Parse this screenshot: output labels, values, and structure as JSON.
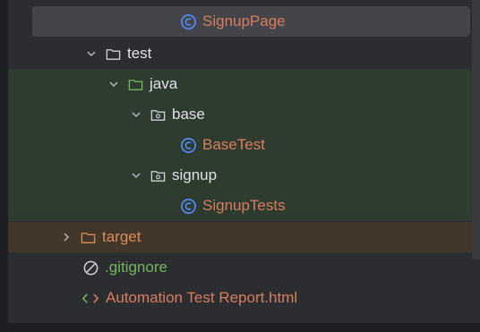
{
  "tree": {
    "items": [
      {
        "label": "SignupPage",
        "icon": "class-icon"
      },
      {
        "label": "test",
        "icon": "folder-icon"
      },
      {
        "label": "java",
        "icon": "source-folder-icon"
      },
      {
        "label": "base",
        "icon": "package-icon"
      },
      {
        "label": "BaseTest",
        "icon": "class-icon"
      },
      {
        "label": "signup",
        "icon": "package-icon"
      },
      {
        "label": "SignupTests",
        "icon": "class-icon"
      },
      {
        "label": "target",
        "icon": "excluded-folder-icon"
      },
      {
        "label": ".gitignore",
        "icon": "ignored-icon"
      },
      {
        "label": "Automation Test Report.html",
        "icon": "html-icon"
      }
    ]
  },
  "colors": {
    "panel_bg": "#2b2d30",
    "selected_bg": "#43454a",
    "test_bg": "#2e3b2f",
    "target_bg": "#413629",
    "class_label": "#d97d5f",
    "git_label": "#72b65e",
    "class_icon": "#548af7"
  }
}
